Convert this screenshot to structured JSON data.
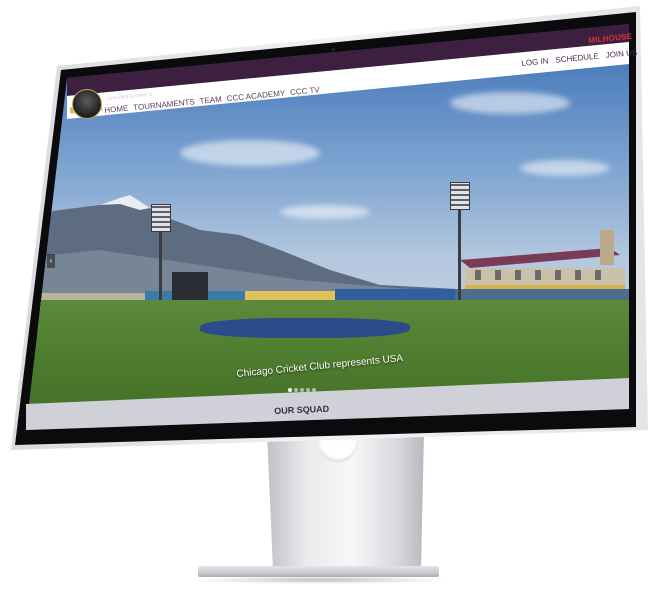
{
  "site": {
    "ad_brand": "MILHOUSE",
    "club_subtitle": "Lino Park Ground, IL",
    "logo_name": "chicago-cricket-club-logo"
  },
  "utility_nav": {
    "items": [
      "LOG IN",
      "SCHEDULE",
      "JOIN US"
    ]
  },
  "main_nav": {
    "items": [
      "HOME",
      "TOURNAMENTS",
      "TEAM",
      "CCC ACADEMY",
      "CCC TV"
    ]
  },
  "hero": {
    "caption": "Chicago Cricket Club represents USA",
    "slide_count": 5,
    "active_slide": 1
  },
  "section": {
    "title": "OUR SQUAD"
  },
  "colors": {
    "topbar": "#3d1f3f",
    "ad_brand": "#e2312b",
    "nav_text": "#5a3d5c",
    "section_band": "#cfd0d8"
  }
}
